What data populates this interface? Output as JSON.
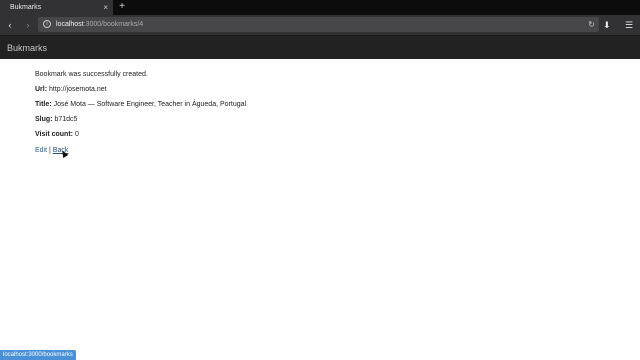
{
  "browser": {
    "tab_title": "Bukmarks",
    "tab_close": "×",
    "new_tab": "+",
    "back": "‹",
    "forward": "›",
    "info": "i",
    "url_host": "localhost",
    "url_path": ":3000/bookmarks/4",
    "reload": "↻",
    "download": "⬇",
    "menu": "☰",
    "status_url": "localhost:3000/bookmarks"
  },
  "app": {
    "brand": "Bukmarks"
  },
  "bookmark": {
    "notice": "Bookmark was successfully created.",
    "url_label": "Url:",
    "url_value": "http://josemota.net",
    "title_label": "Title:",
    "title_value": "José Mota — Software Engineer, Teacher in Águeda, Portugal",
    "slug_label": "Slug:",
    "slug_value": "b71dc5",
    "visit_label": "Visit count:",
    "visit_value": "0"
  },
  "actions": {
    "edit": "Edit",
    "separator": "|",
    "back": "Back"
  }
}
